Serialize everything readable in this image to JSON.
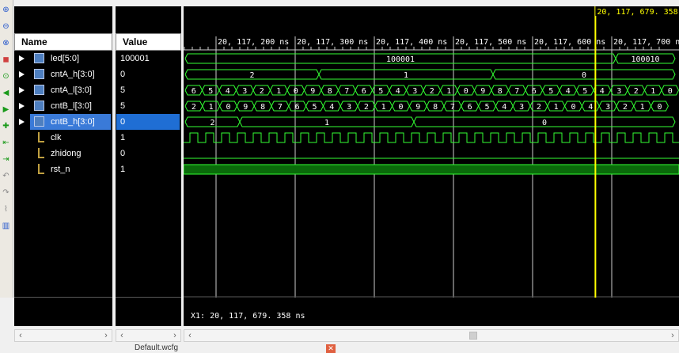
{
  "toolbar": {
    "icons": [
      "zoom-in-icon",
      "zoom-out-icon",
      "zoom-fit-icon",
      "zoom-full-icon",
      "go-to-cursor-icon",
      "previous-edge-icon",
      "next-edge-icon",
      "add-marker-icon",
      "previous-marker-icon",
      "next-marker-icon",
      "swap-cursors-icon",
      "cut-icon",
      "snap-icon",
      "group-icon"
    ]
  },
  "columns": {
    "name": "Name",
    "value": "Value"
  },
  "signals": [
    {
      "name": "led[5:0]",
      "value": "100001",
      "type": "bus",
      "expandable": true,
      "selected": false
    },
    {
      "name": "cntA_h[3:0]",
      "value": "0",
      "type": "bus",
      "expandable": true,
      "selected": false
    },
    {
      "name": "cntA_l[3:0]",
      "value": "5",
      "type": "bus",
      "expandable": true,
      "selected": false
    },
    {
      "name": "cntB_l[3:0]",
      "value": "5",
      "type": "bus",
      "expandable": true,
      "selected": false
    },
    {
      "name": "cntB_h[3:0]",
      "value": "0",
      "type": "bus",
      "expandable": true,
      "selected": true
    },
    {
      "name": "clk",
      "value": "1",
      "type": "bit",
      "expandable": false,
      "selected": false
    },
    {
      "name": "zhidong",
      "value": "0",
      "type": "bit",
      "expandable": false,
      "selected": false
    },
    {
      "name": "rst_n",
      "value": "1",
      "type": "bit",
      "expandable": false,
      "selected": false
    }
  ],
  "timeline": {
    "tick_labels": [
      "20, 117, 200 ns",
      "20, 117, 300 ns",
      "20, 117, 400 ns",
      "20, 117, 500 ns",
      "20, 117, 600 ns",
      "20, 117, 700 ns"
    ],
    "tick_times_ns": [
      20117200,
      20117300,
      20117400,
      20117500,
      20117600,
      20117700
    ],
    "cursor_label": "20, 117, 679. 358 ns",
    "cursor_time_ns": 20117679.358,
    "cursor_readout": "X1: 20, 117, 679. 358 ns"
  },
  "waves": {
    "led": [
      {
        "t0": 20117160,
        "t1": 20117705,
        "v": "100001"
      },
      {
        "t0": 20117705,
        "t1": 20117780,
        "v": "100010"
      }
    ],
    "cntA_h": [
      {
        "t0": 20117160,
        "t1": 20117330,
        "v": "2"
      },
      {
        "t0": 20117330,
        "t1": 20117550,
        "v": "1"
      },
      {
        "t0": 20117550,
        "t1": 20117780,
        "v": "0"
      }
    ],
    "cntA_l": [
      "6",
      "5",
      "4",
      "3",
      "2",
      "1",
      "0",
      "9",
      "8",
      "7",
      "6",
      "5",
      "4",
      "3",
      "2",
      "1",
      "0",
      "9",
      "8",
      "7",
      "6",
      "5",
      "4",
      "5",
      "4",
      "3",
      "2",
      "1",
      "0"
    ],
    "cntB_l": [
      "2",
      "1",
      "0",
      "9",
      "8",
      "7",
      "6",
      "5",
      "4",
      "3",
      "2",
      "1",
      "0",
      "9",
      "8",
      "7",
      "6",
      "5",
      "4",
      "3",
      "2",
      "1",
      "0",
      "4",
      "3",
      "2",
      "1",
      "0"
    ],
    "cntB_h": [
      {
        "t0": 20117160,
        "t1": 20117230,
        "v": "2"
      },
      {
        "t0": 20117230,
        "t1": 20117450,
        "v": "1"
      },
      {
        "t0": 20117450,
        "t1": 20117780,
        "v": "0"
      }
    ]
  },
  "status": {
    "tab_label": "Default.wcfg"
  },
  "colors": {
    "wave": "#33ff33",
    "cursor": "#ffff00",
    "grid": "#cccccc",
    "selection": "#1f6ed4"
  }
}
